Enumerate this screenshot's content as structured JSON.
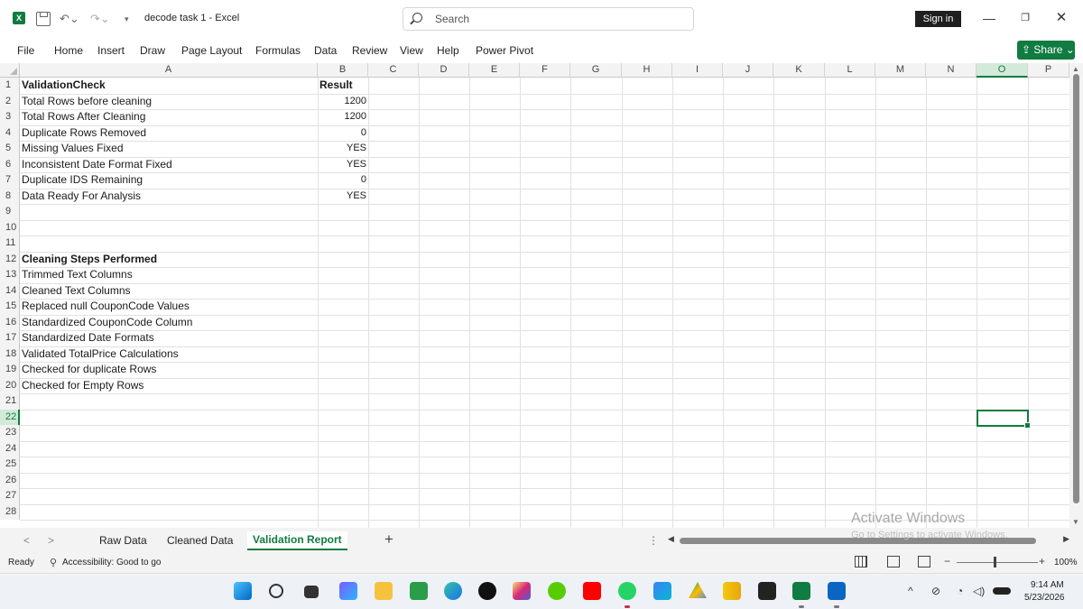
{
  "window": {
    "doc_title": "decode task 1  -  Excel",
    "app_badge": "X",
    "search_placeholder": "Search",
    "signin_label": "Sign in",
    "min_label": "—",
    "restore_label": "❐",
    "close_label": "✕"
  },
  "menu": {
    "items": [
      "File",
      "Home",
      "Insert",
      "Draw",
      "Page Layout",
      "Formulas",
      "Data",
      "Review",
      "View",
      "Help",
      "Power Pivot"
    ],
    "share_label": "Share"
  },
  "grid": {
    "columns": [
      "A",
      "B",
      "C",
      "D",
      "E",
      "F",
      "G",
      "H",
      "I",
      "J",
      "K",
      "L",
      "M",
      "N",
      "O",
      "P"
    ],
    "selected_column": "O",
    "selected_row": "22",
    "row_numbers": [
      "1",
      "2",
      "3",
      "4",
      "5",
      "6",
      "7",
      "8",
      "9",
      "10",
      "11",
      "12",
      "13",
      "14",
      "15",
      "16",
      "17",
      "18",
      "19",
      "20",
      "21",
      "22",
      "23",
      "24",
      "25",
      "26",
      "27",
      "28"
    ],
    "validation": {
      "header_a": "ValidationCheck",
      "header_b": "Result",
      "rows": [
        {
          "check": "Total Rows before cleaning",
          "result": "1200"
        },
        {
          "check": "Total Rows After Cleaning",
          "result": "1200"
        },
        {
          "check": "Duplicate Rows Removed",
          "result": "0"
        },
        {
          "check": "Missing Values Fixed",
          "result": "YES"
        },
        {
          "check": "Inconsistent Date Format Fixed",
          "result": "YES"
        },
        {
          "check": "Duplicate IDS Remaining",
          "result": "0"
        },
        {
          "check": "Data Ready For Analysis",
          "result": "YES"
        }
      ]
    },
    "steps": {
      "header": "Cleaning  Steps Performed",
      "items": [
        "Trimmed Text Columns",
        "Cleaned Text Columns",
        "Replaced null CouponCode Values",
        "Standardized CouponCode Column",
        "Standardized Date Formats",
        "Validated TotalPrice Calculations",
        "Checked for duplicate Rows",
        "Checked for Empty Rows"
      ]
    }
  },
  "sheets": {
    "tabs": [
      "Raw Data",
      "Cleaned Data",
      "Validation Report"
    ],
    "active": "Validation Report",
    "add_label": "+",
    "more_label": "⋮"
  },
  "watermark": {
    "line1": "Activate Windows",
    "line2": "Go to Settings to activate Windows."
  },
  "status": {
    "ready": "Ready",
    "accessibility": "Accessibility: Good to go",
    "zoom_percent": "100%",
    "zoom_minus": "−",
    "zoom_plus": "+"
  },
  "taskbar": {
    "time": "9:14 AM",
    "date": "5/23/2026"
  },
  "colors": {
    "excel_green": "#107c41",
    "selection_header": "#d3e9da"
  }
}
